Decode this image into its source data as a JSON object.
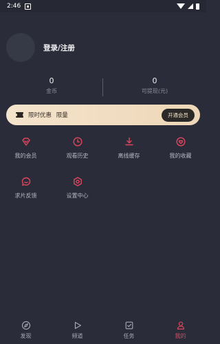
{
  "status_bar": {
    "time": "2:46"
  },
  "profile": {
    "login_label": "登录/注册"
  },
  "stats": [
    {
      "value": "0",
      "label": "金币"
    },
    {
      "value": "0",
      "label": "可提现(元)"
    }
  ],
  "vip_banner": {
    "text_primary": "限时优惠",
    "text_secondary": "限量",
    "button_label": "开通会员"
  },
  "menu": {
    "row1": [
      {
        "label": "我的会员",
        "icon": "diamond-icon"
      },
      {
        "label": "观看历史",
        "icon": "clock-icon"
      },
      {
        "label": "离线缓存",
        "icon": "download-icon"
      },
      {
        "label": "我的收藏",
        "icon": "heart-icon"
      }
    ],
    "row2": [
      {
        "label": "求片反馈",
        "icon": "chat-icon"
      },
      {
        "label": "设置中心",
        "icon": "gear-icon"
      }
    ]
  },
  "tabs": [
    {
      "label": "发现",
      "icon": "compass-icon"
    },
    {
      "label": "频道",
      "icon": "play-icon"
    },
    {
      "label": "任务",
      "icon": "task-icon"
    },
    {
      "label": "我的",
      "icon": "user-icon",
      "active": true
    }
  ],
  "colors": {
    "background": "#2a2d39",
    "accent": "#e0455c",
    "vip_gold": "#f4e4cc"
  }
}
